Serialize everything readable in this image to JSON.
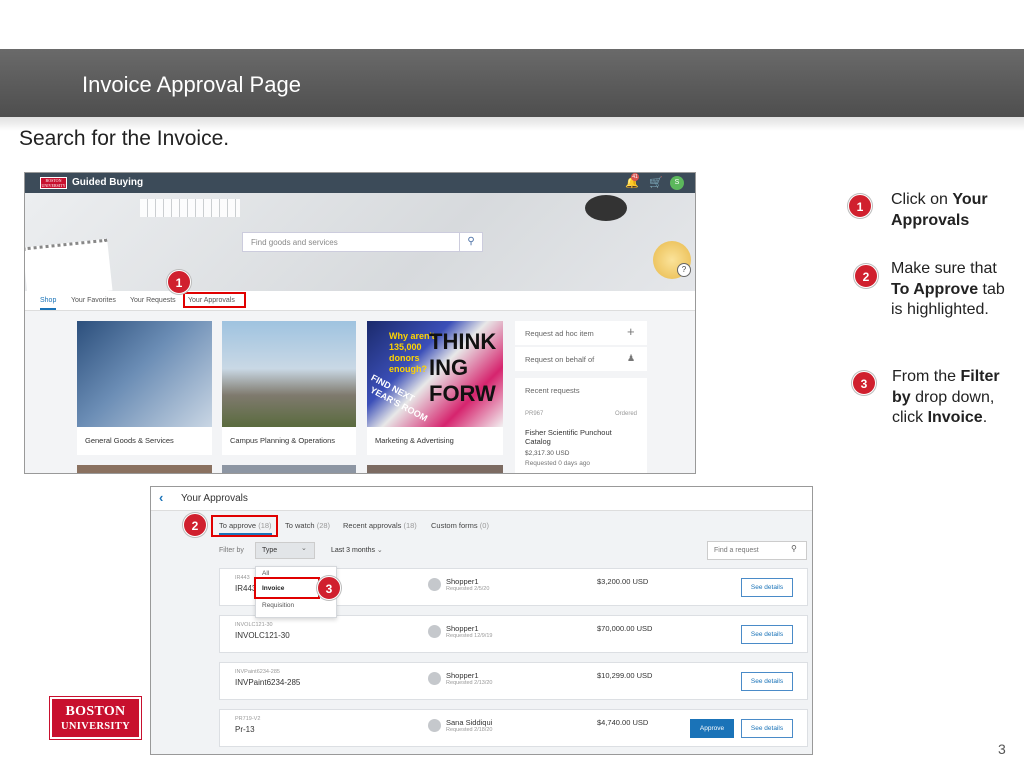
{
  "slide": {
    "title": "Invoice Approval Page",
    "subtitle": "Search for the Invoice.",
    "page_number": "3"
  },
  "logo": {
    "line1": "BOSTON",
    "line2": "UNIVERSITY"
  },
  "steps": [
    {
      "number": "1",
      "pre": "Click on ",
      "bold": "Your Approvals",
      "post": ""
    },
    {
      "number": "2",
      "pre": "Make sure that ",
      "bold": "To Approve",
      "post": " tab is highlighted."
    },
    {
      "number": "3",
      "pre": "From the ",
      "bold": "Filter by",
      "post": " drop down, click ",
      "bold2": "Invoice",
      "post2": "."
    }
  ],
  "guided_buying": {
    "logo_text": "BOSTON UNIVERSITY",
    "app_title": "Guided Buying",
    "notification_count": "41",
    "user_initial": "S",
    "search_placeholder": "Find goods and services",
    "nav": [
      "Shop",
      "Your Favorites",
      "Your Requests",
      "Your Approvals"
    ],
    "cards": [
      {
        "label": "General Goods & Services"
      },
      {
        "label": "Campus Planning & Operations"
      },
      {
        "label": "Marketing & Advertising"
      }
    ],
    "side_actions": [
      "Request ad hoc item",
      "Request on behalf of"
    ],
    "recent_requests": {
      "heading": "Recent requests",
      "id": "PR967",
      "status": "Ordered",
      "name": "Fisher Scientific Punchout Catalog",
      "amount": "$2,317.30 USD",
      "requested": "Requested 0 days ago"
    },
    "marketing_overlay": [
      "Why aren't",
      "135,000",
      "donors",
      "enough?",
      "THINK",
      "ING",
      "FORW",
      "FIND NEXT",
      "YEAR'S ROOM"
    ]
  },
  "approvals": {
    "title": "Your Approvals",
    "tabs": [
      {
        "label": "To approve",
        "count": "(18)"
      },
      {
        "label": "To watch",
        "count": "(28)"
      },
      {
        "label": "Recent approvals",
        "count": "(18)"
      },
      {
        "label": "Custom forms",
        "count": "(0)"
      }
    ],
    "filter_label": "Filter by",
    "filter_value": "Type",
    "range_value": "Last 3 months",
    "find_placeholder": "Find a request",
    "dropdown": [
      "All",
      "Invoice",
      "Requisition"
    ],
    "rows": [
      {
        "small_id": "IR443",
        "id": "IR443",
        "name": "Shopper1",
        "date": "Requested 2/5/20",
        "amount": "$3,200.00 USD",
        "see": "See details"
      },
      {
        "small_id": "INVOLC121-30",
        "id": "INVOLC121-30",
        "name": "Shopper1",
        "date": "Requested 12/9/19",
        "amount": "$70,000.00 USD",
        "see": "See details"
      },
      {
        "small_id": "INVPaint6234-285",
        "id": "INVPaint6234-285",
        "name": "Shopper1",
        "date": "Requested 2/13/20",
        "amount": "$10,299.00 USD",
        "see": "See details"
      },
      {
        "small_id": "PR719-V2",
        "id": "Pr-13",
        "name": "Sana Siddiqui",
        "date": "Requested 2/18/20",
        "amount": "$4,740.00 USD",
        "see": "See details",
        "approve": "Approve"
      }
    ]
  },
  "colors": {
    "highlight": "#e00000",
    "badge": "#d0202e",
    "bu_red": "#c8102e",
    "header_gray": "#595959",
    "sap_blue": "#1a73b8"
  },
  "icons": [
    "search-icon",
    "bell-icon",
    "cart-icon",
    "help-icon",
    "plus-icon",
    "person-plus-icon",
    "back-chevron-icon",
    "chevron-down-icon",
    "user-avatar-icon"
  ]
}
